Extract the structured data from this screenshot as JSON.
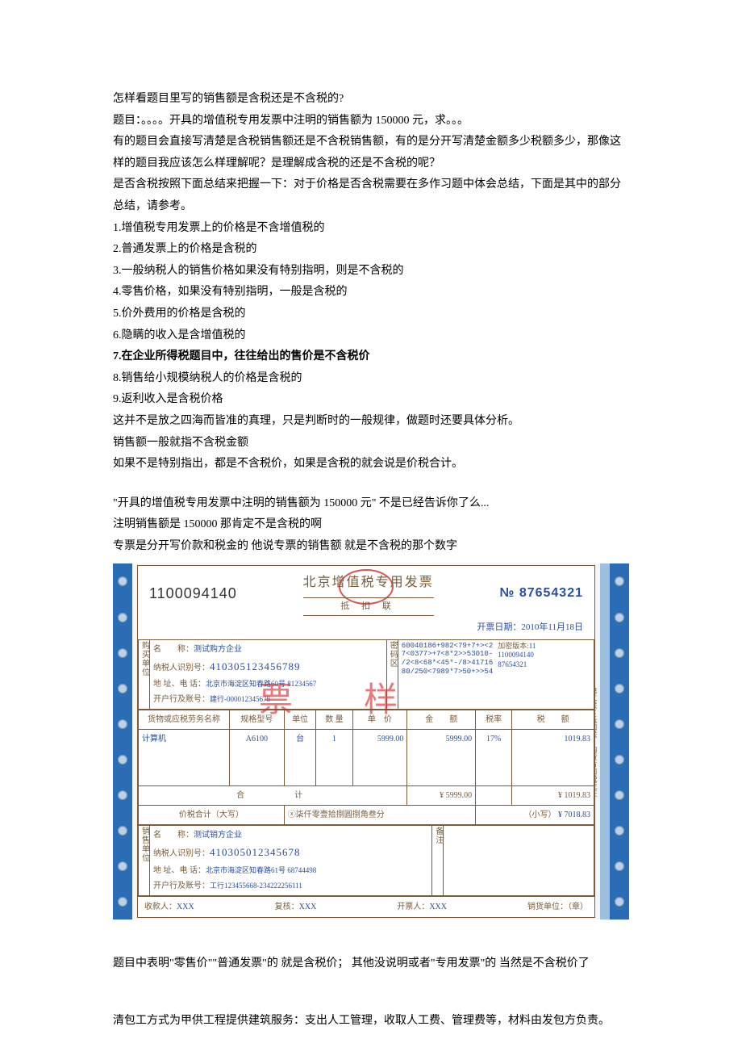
{
  "para": {
    "p1": "怎样看题目里写的销售额是含税还是不含税的?",
    "p2": "题目：。。。。开具的增值税专用发票中注明的销售额为 150000 元，求。。。",
    "p3": "有的题目会直接写清楚是含税销售额还是不含税销售额，有的是分开写清楚金额多少税额多少，那像这样的题目我应该怎么样理解呢？是理解成含税的还是不含税的呢？",
    "p4": "是否含税按照下面总结来把握一下：对于价格是否含税需要在多作习题中体会总结，下面是其中的部分总结，请参考。",
    "l1": "1.增值税专用发票上的价格是不含增值税的",
    "l2": "2.普通发票上的价格是含税的",
    "l3": "3.一般纳税人的销售价格如果没有特别指明，则是不含税的",
    "l4": "4.零售价格，如果没有特别指明，一般是含税的",
    "l5": "5.价外费用的价格是含税的",
    "l6": "6.隐瞒的收入是含增值税的",
    "l7": "7.在企业所得税题目中，往往给出的售价是不含税价",
    "l8": "8.销售给小规模纳税人的价格是含税的",
    "l9": "9.返利收入是含税价格",
    "p5": "这并不是放之四海而皆准的真理，只是判断时的一般规律，做题时还要具体分析。",
    "p6": "销售额一般就指不含税金额",
    "p7": "如果不是特别指出，都是不含税价，如果是含税的就会说是价税合计。",
    "p8": "\"开具的增值税专用发票中注明的销售额为 150000 元\"  不是已经告诉你了么...",
    "p9": " 注明销售额是 150000   那肯定不是含税的啊",
    "p10": "专票是分开写价款和税金的 他说专票的销售额 就是不含税的那个数字",
    "p11": "题目中表明\"零售价\"\"普通发票\"的 就是含税价；  其他没说明或者\"专用发票\"的 当然是不含税价了",
    "p12": "清包工方式为甲供工程提供建筑服务：支出人工管理，收取人工费、管理费等，材料由发包方负责。"
  },
  "invoice": {
    "code": "1100094140",
    "title": "北京增值税专用发票",
    "sub_title": "抵  扣  联",
    "no_label": "№",
    "no": "87654321",
    "date_label": "开票日期：",
    "date": "2010年11月18日",
    "buyer": {
      "side": "购买单位",
      "name_label": "名　　称：",
      "name": "测试购方企业",
      "tax_label": "纳税人识别号：",
      "tax": "410305123456789",
      "addr_label": "地 址、电 话：",
      "addr": "北京市海淀区知春路60号 81234567",
      "bank_label": "开户行及账号：",
      "bank": "建行-000012345678"
    },
    "cipher": {
      "side": "密码区",
      "line1": "60040186+982<79+7+><2",
      "line2": "7<0377>+7<8*2>>53010-",
      "line3": "/2<8<68*<45*-/8>41716",
      "line4": "80/250<7989*7>50+>>54",
      "meta1_label": "加密版本:",
      "meta1": "11",
      "meta2": "1100094140",
      "meta3": "87654321"
    },
    "columns": {
      "c1": "货物或应税劳务名称",
      "c2": "规格型号",
      "c3": "单位",
      "c4": "数 量",
      "c5": "单　价",
      "c6": "金　　额",
      "c7": "税率",
      "c8": "税　　额"
    },
    "item": {
      "name": "计算机",
      "model": "A6100",
      "unit": "台",
      "qty": "1",
      "price": "5999.00",
      "amount": "5999.00",
      "rate": "17%",
      "tax": "1019.83"
    },
    "total": {
      "label": "合　　　计",
      "amount": "¥ 5999.00",
      "tax": "¥ 1019.83"
    },
    "sum": {
      "label": "价税合计（大写）",
      "cn": "ⓧ柒仟零壹拾捌圆捌角叁分",
      "small_label": "（小写）",
      "small": "¥ 7018.83"
    },
    "seller": {
      "side": "销售单位",
      "name_label": "名　　称：",
      "name": "测试销方企业",
      "tax_label": "纳税人识别号：",
      "tax": "410305012345678",
      "addr_label": "地 址、电 话：",
      "addr": "北京市海淀区知春路61号 68744498",
      "bank_label": "开户行及账号：",
      "bank": "工行123455668-234222256111"
    },
    "remark_side": "备注",
    "footer": {
      "payee_label": "收款人：",
      "payee": "XXX",
      "check_label": "复核：",
      "check": "XXX",
      "issuer_label": "开票人：",
      "issuer": "XXX",
      "unit_label": "销货单位：（章）"
    },
    "side_left": "国税函 [2009] 335 号南京印刷厂",
    "side_right": "第二联：抵扣联 购货方扣税凭证"
  }
}
